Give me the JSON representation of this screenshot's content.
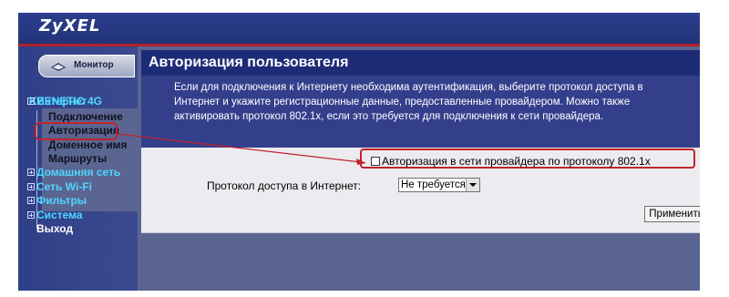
{
  "brand": {
    "logo": "ZyXEL"
  },
  "sidebar": {
    "monitor_label": "Монитор",
    "model": "KEENETIC 4G",
    "items": [
      {
        "label": "Интернет",
        "level": 0
      },
      {
        "label": "Подключение",
        "level": 1
      },
      {
        "label": "Авторизация",
        "level": 1,
        "active": true
      },
      {
        "label": "Доменное имя",
        "level": 1
      },
      {
        "label": "Маршруты",
        "level": 1
      },
      {
        "label": "Домашняя сеть",
        "level": 0
      },
      {
        "label": "Сеть Wi-Fi",
        "level": 0
      },
      {
        "label": "Фильтры",
        "level": 0
      },
      {
        "label": "Система",
        "level": 0
      },
      {
        "label": "Выход",
        "level": 0
      }
    ]
  },
  "page": {
    "title": "Авторизация пользователя",
    "description": "Если для подключения к Интернету необходима аутентификация, выберите протокол доступа в Интернет и укажите регистрационные данные, предоставленные провайдером. Можно также активировать протокол 802.1x, если это требуется для подключения к сети провайдера."
  },
  "form": {
    "checkbox_label": "Авторизация в сети провайдера по протоколу 802.1x",
    "checkbox_checked": false,
    "protocol_label": "Протокол доступа в Интернет:",
    "protocol_value": "Не требуется",
    "apply_label": "Применить"
  },
  "colors": {
    "accent_red": "#c1232b",
    "nav_cyan": "#50d7ff",
    "header_navy": "#1e2c78"
  }
}
